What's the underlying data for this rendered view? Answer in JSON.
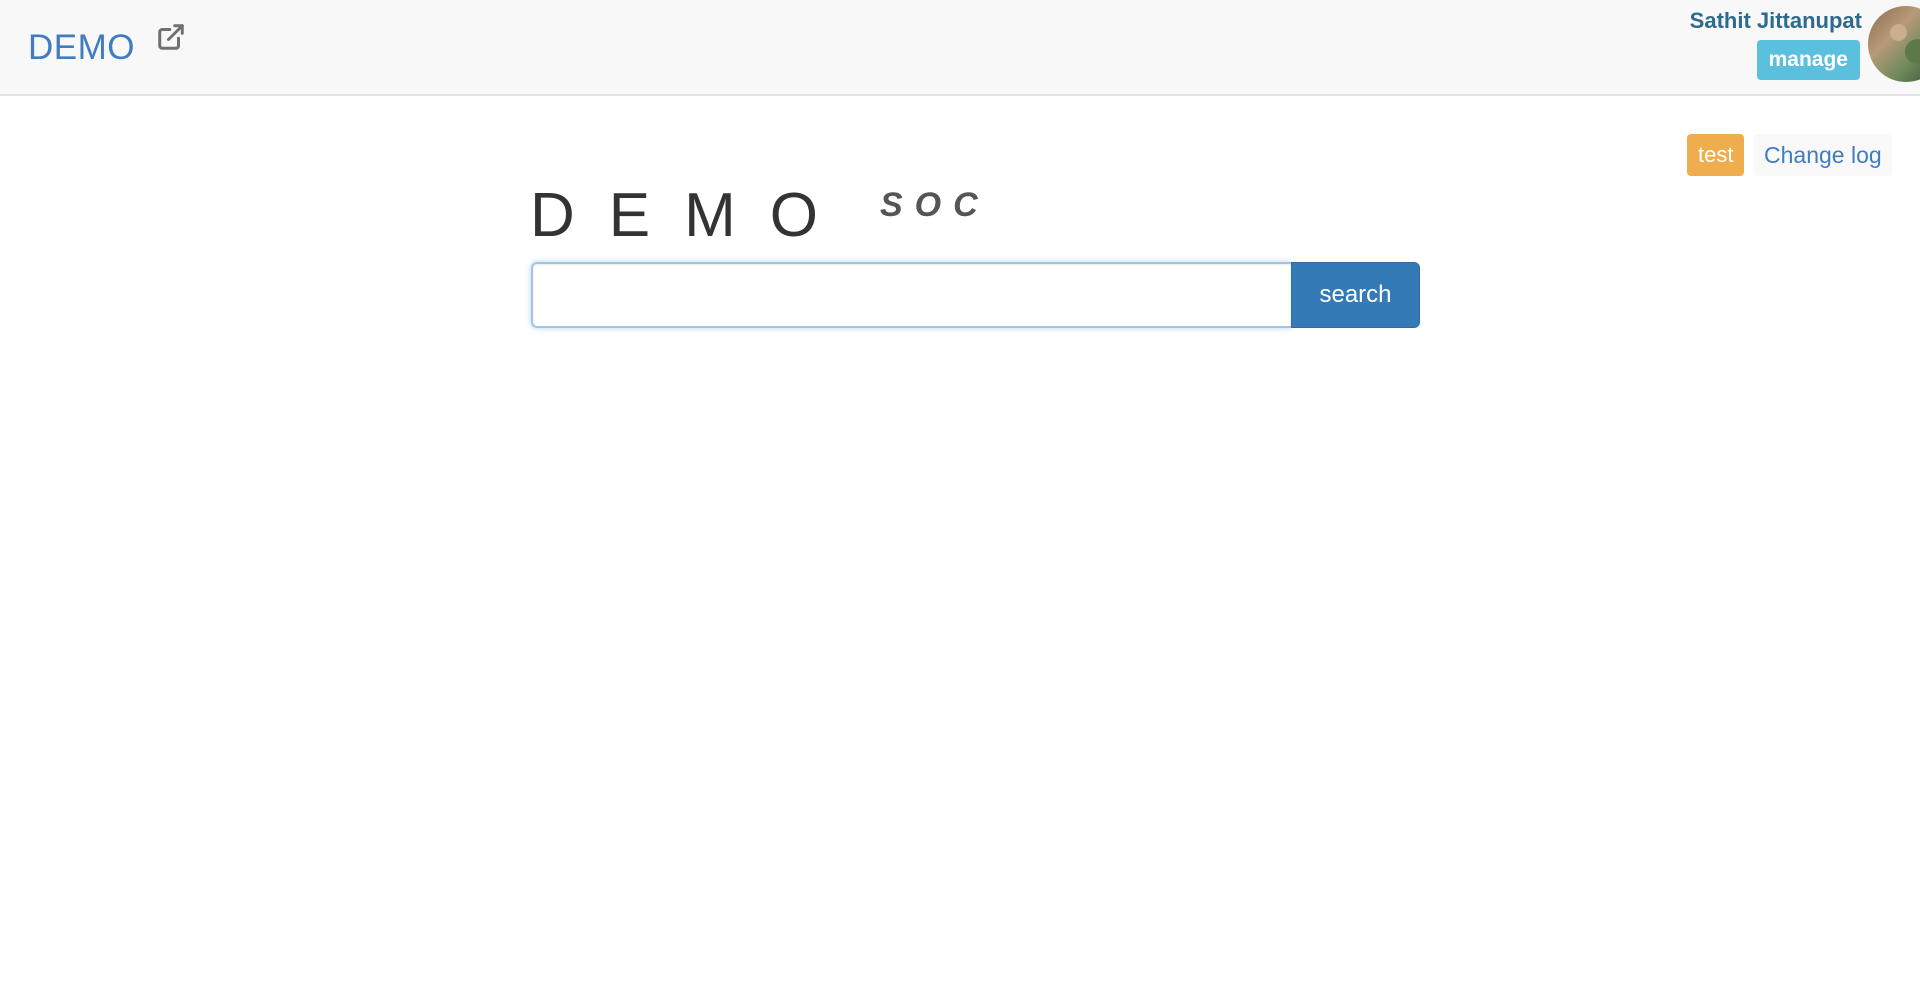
{
  "navbar": {
    "brand": "DEMO",
    "external_icon": "external-link-icon",
    "user_name": "Sathit Jittanupat",
    "manage_label": "manage"
  },
  "actions": {
    "test_label": "test",
    "changelog_label": "Change log"
  },
  "logo": {
    "main": "DEMO",
    "sub": "SOC"
  },
  "search": {
    "value": "",
    "placeholder": "",
    "button_label": "search"
  },
  "colors": {
    "brand": "#3f7cc0",
    "manage_button": "#5bc0de",
    "test_badge": "#f0ad4e",
    "search_button": "#337ab7"
  }
}
